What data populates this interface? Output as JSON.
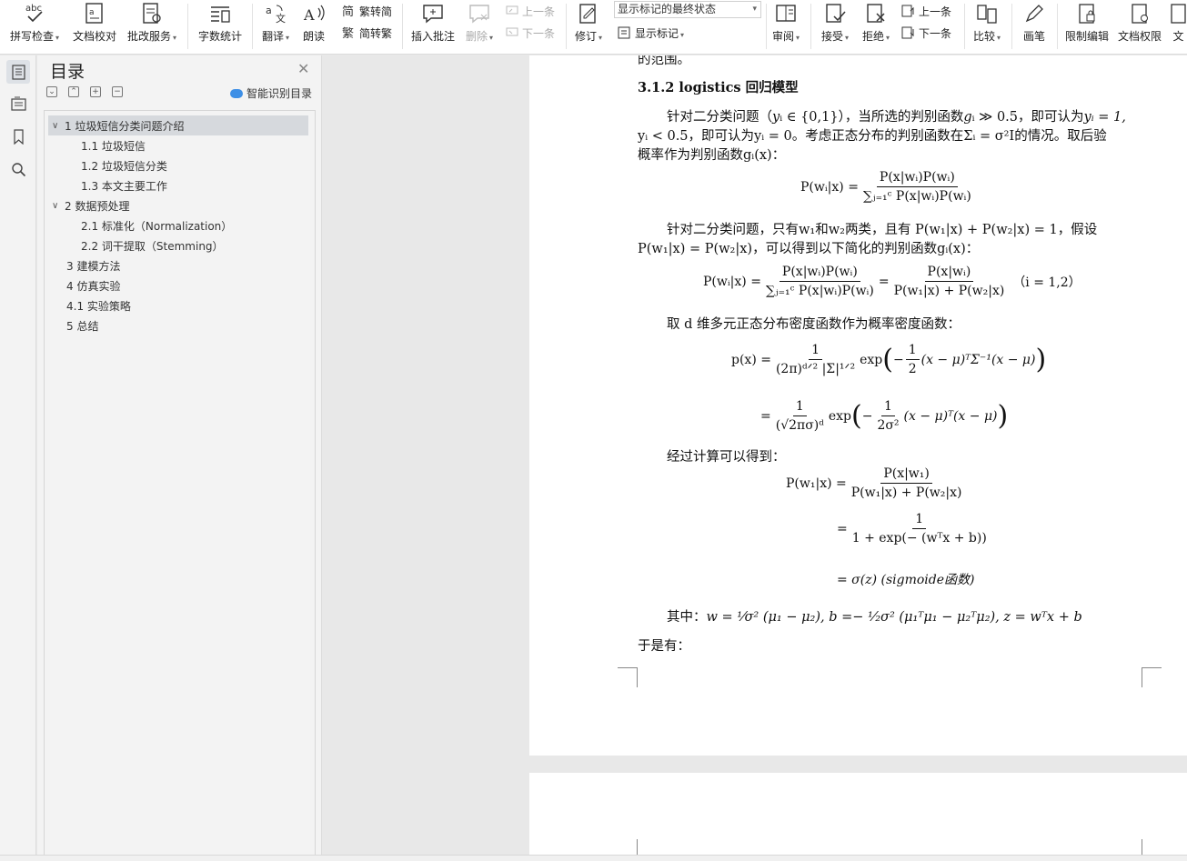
{
  "ribbon": {
    "spell_check": "拼写检查",
    "doc_proof": "文档校对",
    "review_service": "批改服务",
    "word_count": "字数统计",
    "translate": "翻译",
    "read_aloud": "朗读",
    "trad_to_simp": "繁转简",
    "simp_to_trad": "简转繁",
    "insert_comment": "插入批注",
    "delete": "删除",
    "prev_comment": "上一条",
    "next_comment": "下一条",
    "track_changes": "修订",
    "markup_state": "显示标记的最终状态",
    "show_markup": "显示标记",
    "reviewing": "审阅",
    "accept": "接受",
    "reject": "拒绝",
    "prev_change": "上一条",
    "next_change": "下一条",
    "compare": "比较",
    "ink": "画笔",
    "restrict_edit": "限制编辑",
    "doc_permission": "文档权限",
    "doc_more": "文"
  },
  "toc": {
    "title": "目录",
    "smart_toc": "智能识别目录",
    "items": [
      {
        "label": "1 垃圾短信分类问题介绍"
      },
      {
        "label": "1.1  垃圾短信"
      },
      {
        "label": "1.2  垃圾短信分类"
      },
      {
        "label": "1.3  本文主要工作"
      },
      {
        "label": "2  数据预处理"
      },
      {
        "label": "2.1  标准化（Normalization）"
      },
      {
        "label": "2.2  词干提取（Stemming）"
      },
      {
        "label": "3  建模方法"
      },
      {
        "label": "4  仿真实验"
      },
      {
        "label": "4.1  实验策略"
      },
      {
        "label": "5  总结"
      }
    ]
  },
  "document": {
    "cut_top": "的范围。",
    "heading": "3.1.2 logistics 回归模型",
    "p1_a": "针对二分类问题（",
    "p1_b": "y",
    "p1_c": "ᵢ ∈ {0,1}），当所选的判别函数",
    "p1_d": "g",
    "p1_e": "ᵢ ≫ 0.5，即可认为",
    "p1_f": "yᵢ = 1,",
    "p1_line2": "yᵢ < 0.5，即可认为yᵢ = 0。考虑正态分布的判别函数在Σᵢ = σ²I的情况。取后验",
    "p1_line3": "概率作为判别函数gᵢ(x)：",
    "eq1_lhs": "P(wᵢ|x) =",
    "eq1_num": "P(x|wᵢ)P(wᵢ)",
    "eq1_den": "∑ⱼ₌₁ᶜ P(x|wᵢ)P(wᵢ)",
    "p2_line1": "针对二分类问题，只有w₁和w₂两类，且有 P(w₁|x) + P(w₂|x) = 1，假设",
    "p2_line2": "P(w₁|x) = P(w₂|x)，可以得到以下简化的判别函数gᵢ(x)：",
    "eq2_lhs": "P(wᵢ|x) =",
    "eq2_num1": "P(x|wᵢ)P(wᵢ)",
    "eq2_den1": "∑ⱼ₌₁ᶜ P(x|wᵢ)P(wᵢ)",
    "eq2_mid": "=",
    "eq2_num2": "P(x|wᵢ)",
    "eq2_den2": "P(w₁|x) + P(w₂|x)",
    "eq2_cond": "（i = 1,2）",
    "p3": "取 d 维多元正态分布密度函数作为概率密度函数：",
    "eq3_lhs": "p(x) =",
    "eq3_num": "1",
    "eq3_den": "(2π)ᵈᐟ² |Σ|¹ᐟ²",
    "eq3_exp": "exp",
    "eq3_in_num": "1",
    "eq3_in_den": "2",
    "eq3_tail": "(x − μ)ᵀΣ⁻¹(x − μ)",
    "eq4_lhs": "=",
    "eq4_num": "1",
    "eq4_den": "(√2πσ)ᵈ",
    "eq4_exp": "exp",
    "eq4_in_num": "1",
    "eq4_in_den": "2σ²",
    "eq4_tail": "(x − μ)ᵀ(x − μ)",
    "p4": "经过计算可以得到：",
    "eq5_lhs": "P(w₁|x) =",
    "eq5_num": "P(x|w₁)",
    "eq5_den": "P(w₁|x) + P(w₂|x)",
    "eq6_lhs": "=",
    "eq6_num": "1",
    "eq6_den": "1 + exp(− (wᵀx + b))",
    "eq7": "= σ(z)   (sigmoide函数)",
    "p5_label": "其中：",
    "p5_eq": "w = ¹⁄σ² (μ₁ − μ₂), b =− ¹⁄₂σ² (μ₁ᵀμ₁ − μ₂ᵀμ₂), z = wᵀx + b",
    "p6": "于是有："
  }
}
